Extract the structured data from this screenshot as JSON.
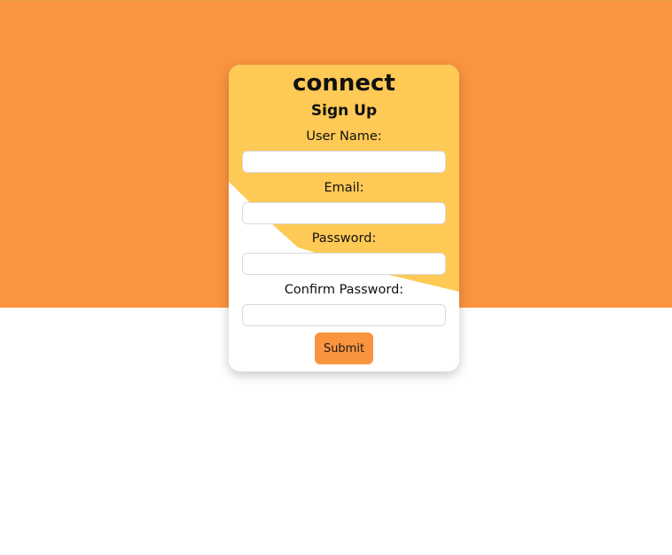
{
  "colors": {
    "hero_background": "#fb943f",
    "card_accent": "#fec955",
    "card_background": "#ffffff",
    "button_background": "#fb943f"
  },
  "card": {
    "brand": "connect",
    "title": "Sign Up",
    "fields": [
      {
        "label": "User Name:",
        "value": "",
        "placeholder": ""
      },
      {
        "label": "Email:",
        "value": "",
        "placeholder": ""
      },
      {
        "label": "Password:",
        "value": "",
        "placeholder": ""
      },
      {
        "label": "Confirm Password:",
        "value": "",
        "placeholder": ""
      }
    ],
    "submit_label": "Submit"
  }
}
